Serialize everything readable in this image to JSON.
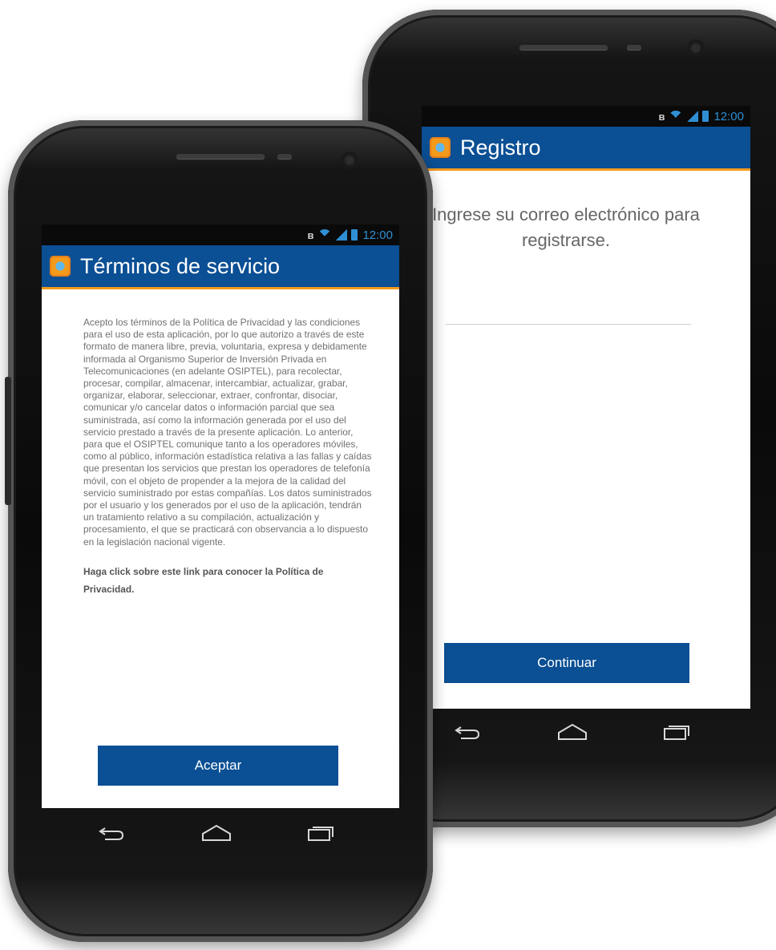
{
  "colors": {
    "primary": "#0b4f94",
    "accent": "#f39a1c",
    "status_icon": "#2f8fd4"
  },
  "terms_screen": {
    "status_time": "12:00",
    "title": "Términos de servicio",
    "body": "Acepto los términos de la Política de Privacidad y las condiciones para el uso de esta aplicación, por lo que autorizo a través de este formato de manera libre, previa, voluntaria, expresa y debidamente informada al Organismo Superior de Inversión Privada en Telecomunicaciones (en adelante OSIPTEL), para recolectar, procesar, compilar, almacenar, intercambiar, actualizar, grabar, organizar, elaborar, seleccionar, extraer, confrontar, disociar, comunicar y/o cancelar datos o información parcial que sea suministrada, así como la información generada por el uso del servicio prestado a través de la presente aplicación. Lo anterior, para que el OSIPTEL comunique tanto a los operadores móviles, como al público, información estadística relativa a las fallas y caídas que presentan los servicios que prestan los operadores de telefonía móvil, con el objeto de propender a la mejora de la calidad del servicio suministrado por estas compañías. Los datos suministrados por el usuario y los generados por el uso de la aplicación, tendrán un tratamiento relativo a su compilación, actualización y procesamiento, el que se practicará con observancia a lo dispuesto en la legislación nacional vigente.",
    "link_text": "Haga click sobre este link para conocer la Política de Privacidad.",
    "accept_label": "Aceptar"
  },
  "register_screen": {
    "status_time": "12:00",
    "title": "Registro",
    "prompt": "Ingrese su correo electrónico para registrarse.",
    "email_value": "",
    "email_placeholder": "",
    "continue_label": "Continuar"
  },
  "icons": {
    "back": "back-arrow-icon",
    "home": "home-icon",
    "recents": "recent-apps-icon",
    "app": "app-logo-icon",
    "bluetooth": "bluetooth-icon",
    "wifi": "wifi-icon",
    "signal": "signal-icon",
    "battery": "battery-icon"
  }
}
